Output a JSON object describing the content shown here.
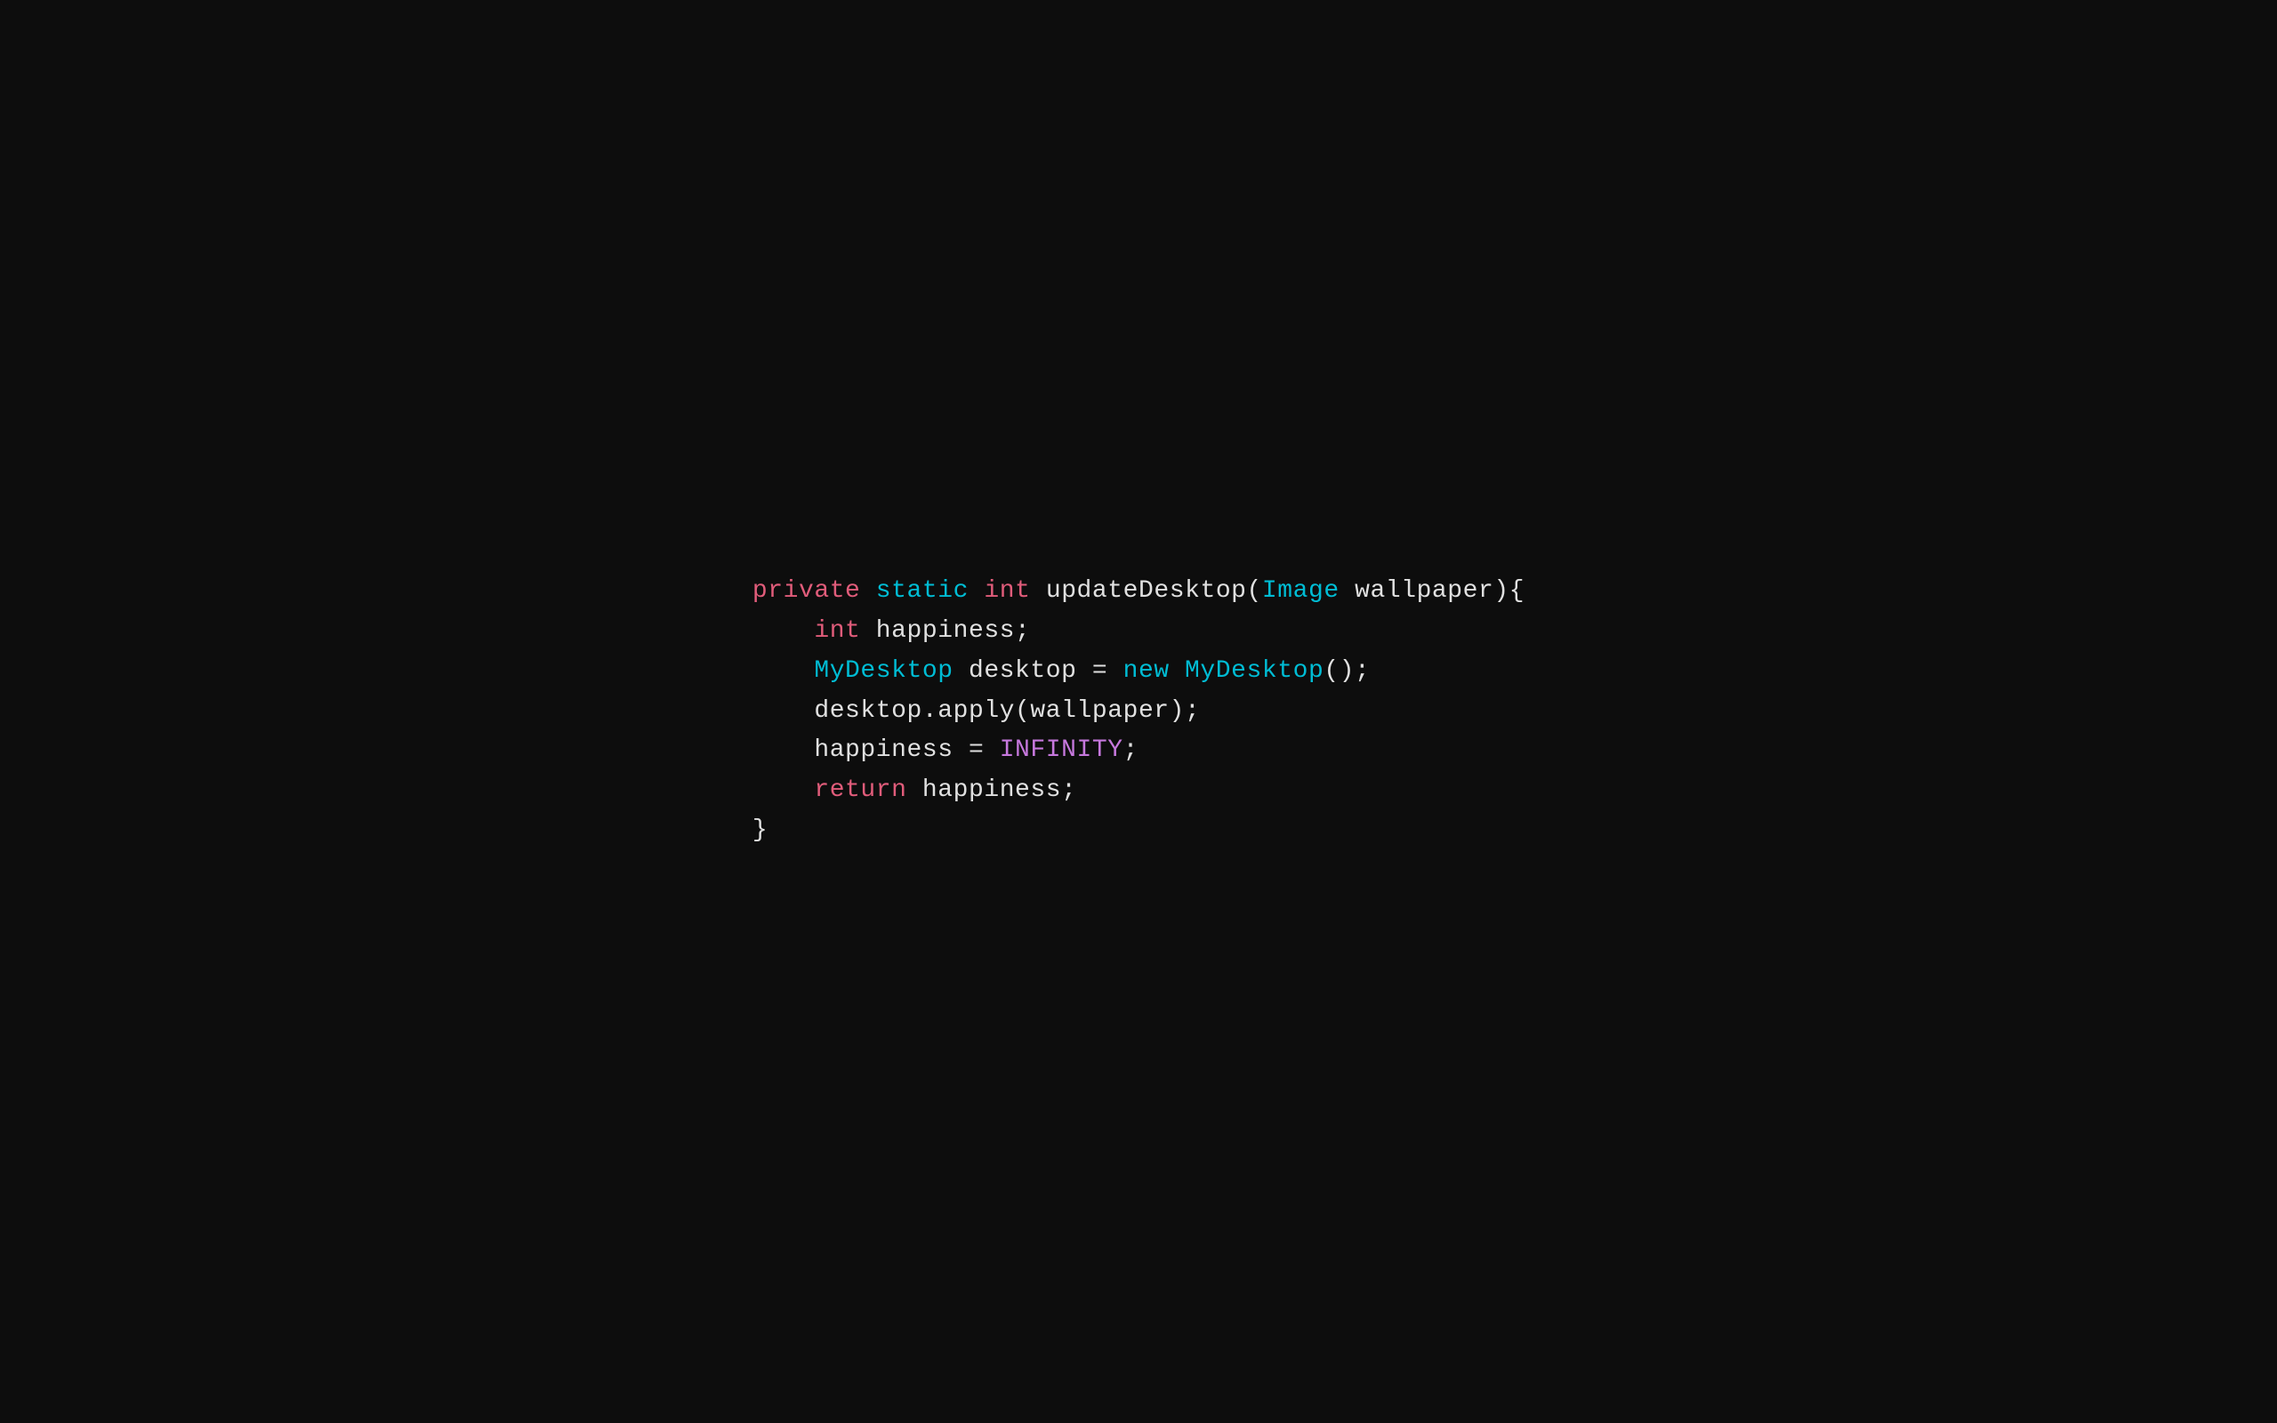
{
  "code": {
    "line1": {
      "keyword_private": "private",
      "keyword_static": "static",
      "keyword_int": "int",
      "method": "updateDesktop(",
      "type_image": "Image",
      "rest": " wallpaper){"
    },
    "line2": {
      "keyword_int": "int",
      "rest": " happiness;"
    },
    "line3": {
      "type_mydesktop": "MyDesktop",
      "rest1": " desktop = ",
      "keyword_new": "new",
      "type_mydesktop2": " MyDesktop",
      "rest2": "();"
    },
    "line4": {
      "text": "desktop.apply(wallpaper);"
    },
    "line5": {
      "text1": "happiness = ",
      "constant": "INFINITY",
      "text2": ";"
    },
    "line6": {
      "keyword_return": "return",
      "rest": " happiness;"
    },
    "line7": {
      "text": "}"
    }
  }
}
